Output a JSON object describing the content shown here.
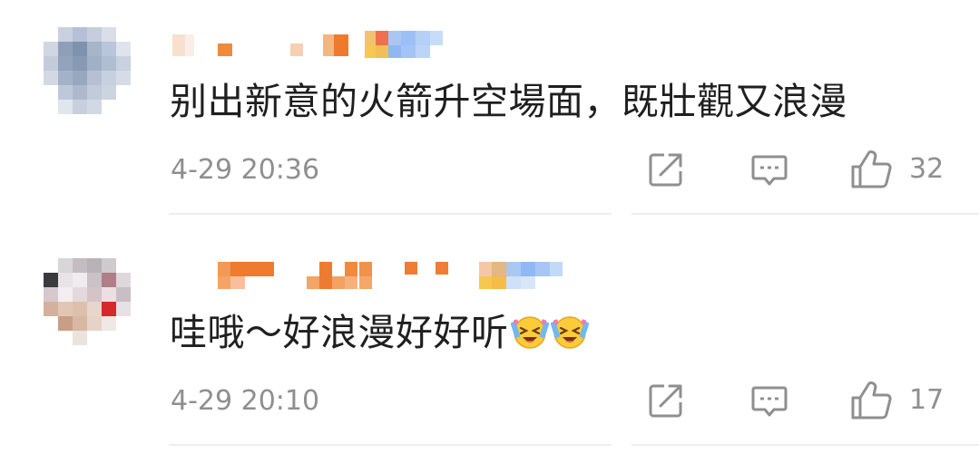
{
  "comments": [
    {
      "text": "别出新意的火箭升空場面，既壯觀又浪漫",
      "timestamp": "4-29 20:36",
      "like_count": "32",
      "emoji": []
    },
    {
      "text": "哇哦～好浪漫好好听",
      "timestamp": "4-29 20:10",
      "like_count": "17",
      "emoji": [
        "laughing-tears-emoji",
        "laughing-tears-emoji"
      ]
    }
  ],
  "icons": {
    "share": "share-icon",
    "reply": "comment-icon",
    "like": "thumbs-up-icon"
  },
  "colors": {
    "text": "#1f1f1f",
    "meta": "#8f8f8f",
    "divider": "#eeeeee"
  }
}
